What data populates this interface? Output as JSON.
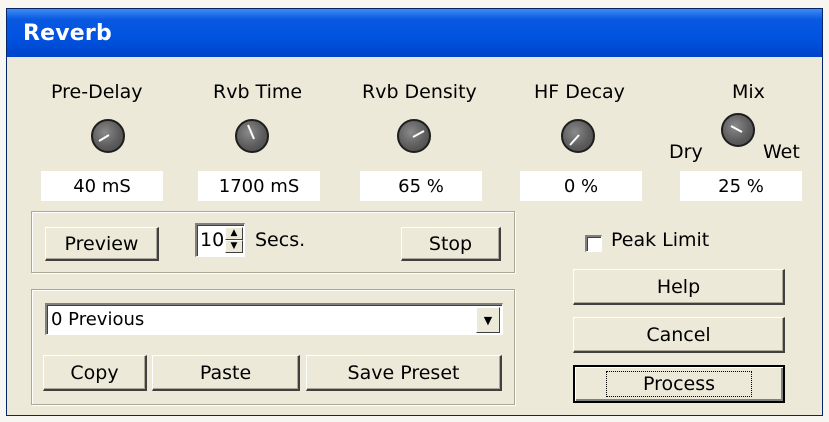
{
  "window": {
    "title": "Reverb"
  },
  "controls": {
    "pre_delay": {
      "label": "Pre-Delay",
      "value": "40 mS",
      "icon": "knob-icon"
    },
    "rvb_time": {
      "label": "Rvb Time",
      "value": "1700 mS",
      "icon": "knob-icon"
    },
    "rvb_density": {
      "label": "Rvb Density",
      "value": "65 %",
      "icon": "knob-icon"
    },
    "hf_decay": {
      "label": "HF Decay",
      "value": "0 %",
      "icon": "knob-icon"
    },
    "mix": {
      "label": "Mix",
      "dry_label": "Dry",
      "wet_label": "Wet",
      "value": "25 %",
      "icon": "knob-icon"
    }
  },
  "preview": {
    "preview_label": "Preview",
    "seconds_value": "10",
    "seconds_label": "Secs.",
    "stop_label": "Stop"
  },
  "presets": {
    "selected": "0 Previous",
    "copy_label": "Copy",
    "paste_label": "Paste",
    "save_label": "Save Preset"
  },
  "options": {
    "peak_limit_label": "Peak Limit",
    "peak_limit_checked": false
  },
  "actions": {
    "help_label": "Help",
    "cancel_label": "Cancel",
    "process_label": "Process"
  },
  "colors": {
    "titlebar": "#0053e0",
    "dialog_bg": "#ece9d8",
    "knob": "#5d5d5d"
  }
}
